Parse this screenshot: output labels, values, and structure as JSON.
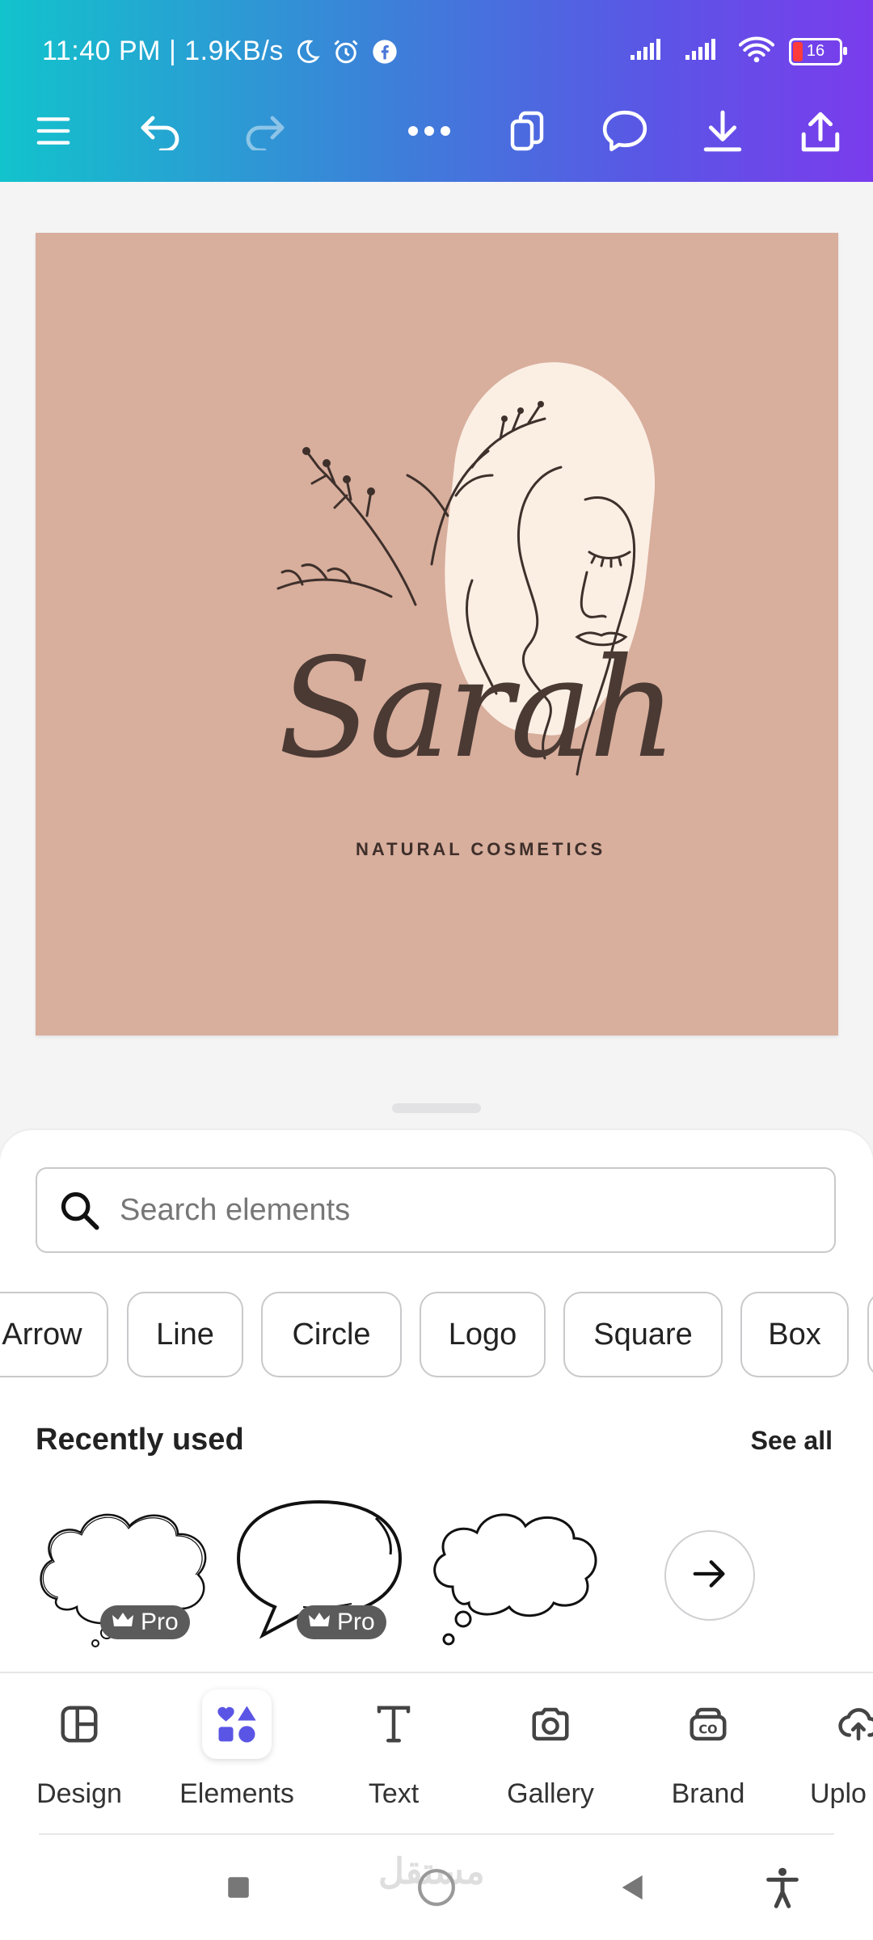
{
  "status_bar": {
    "time_speed": "11:40 PM | 1.9KB/s",
    "battery": "16"
  },
  "design": {
    "brand_name": "Sarah",
    "tagline": "NATURAL COSMETICS"
  },
  "search": {
    "placeholder": "Search elements"
  },
  "chips": [
    "Arrow",
    "Line",
    "Circle",
    "Logo",
    "Square",
    "Box"
  ],
  "recently_used": {
    "title": "Recently used",
    "see_all": "See all",
    "pro_label": "Pro"
  },
  "nav": {
    "design": "Design",
    "elements": "Elements",
    "text": "Text",
    "gallery": "Gallery",
    "brand": "Brand",
    "uploads": "Uplo"
  },
  "watermark": "مستقل",
  "colors": {
    "canvas_bg": "#d8ae9d",
    "accent": "#5b55e6",
    "gradient_start": "#12c3cc",
    "gradient_end": "#7a3cec"
  }
}
